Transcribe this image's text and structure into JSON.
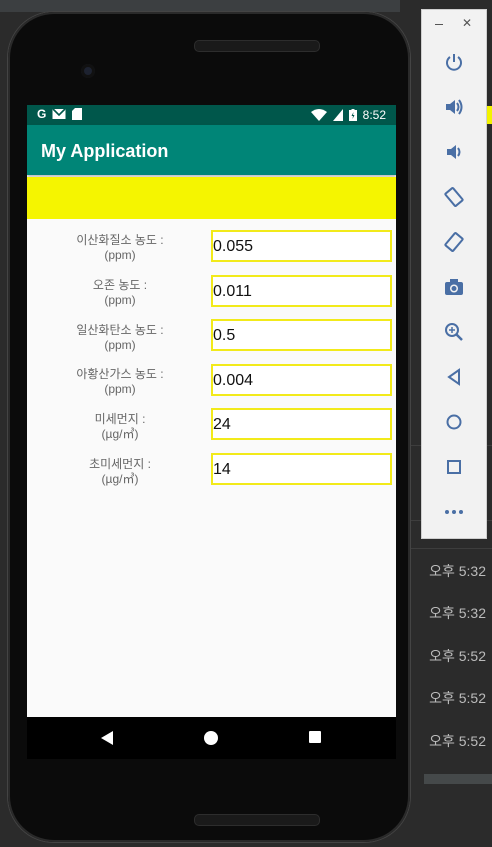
{
  "app": {
    "title": "My Application"
  },
  "statusbar": {
    "time": "8:52"
  },
  "form": {
    "rows": [
      {
        "label": "이산화질소 농도    :",
        "unit": "(ppm)",
        "value": "0.055"
      },
      {
        "label": "오존          농도    :",
        "unit": "(ppm)",
        "value": "0.011"
      },
      {
        "label": "일산화탄소 농도    :",
        "unit": "(ppm)",
        "value": "0.5"
      },
      {
        "label": "아황산가스 농도    :",
        "unit": "(ppm)",
        "value": "0.004"
      },
      {
        "label": "미세먼지            :",
        "unit": "(µg/㎥)",
        "value": "24"
      },
      {
        "label": "초미세먼지          :",
        "unit": "(µg/㎥)",
        "value": "14"
      }
    ]
  },
  "ide": {
    "log_times": [
      "오후 5:32",
      "오후 5:32",
      "오후 5:52",
      "오후 5:52",
      "오후 5:52"
    ]
  },
  "emulator_toolbar": {
    "buttons": [
      "power-icon",
      "volume-up-icon",
      "volume-down-icon",
      "rotate-left-icon",
      "rotate-right-icon",
      "camera-icon",
      "zoom-icon",
      "back-icon",
      "home-icon",
      "overview-icon",
      "more-icon"
    ]
  },
  "colors": {
    "appbar": "#008577",
    "statusbar": "#00574b",
    "banner": "#f5f500",
    "input_border": "#f2ea1a"
  }
}
